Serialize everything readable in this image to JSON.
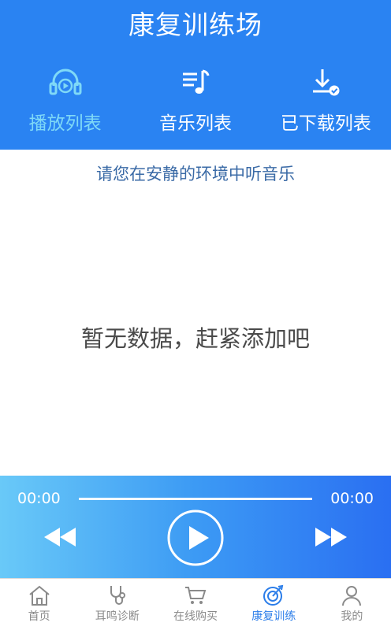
{
  "header": {
    "title": "康复训练场",
    "tabs": [
      {
        "label": "播放列表",
        "icon": "headphones-play-icon",
        "active": true
      },
      {
        "label": "音乐列表",
        "icon": "music-list-icon",
        "active": false
      },
      {
        "label": "已下载列表",
        "icon": "download-done-icon",
        "active": false
      }
    ]
  },
  "main": {
    "hint": "请您在安静的环境中听音乐",
    "empty_message": "暂无数据，赶紧添加吧"
  },
  "player": {
    "current_time": "00:00",
    "total_time": "00:00",
    "progress": 0,
    "controls": [
      "rewind-icon",
      "play-icon",
      "fast-forward-icon"
    ]
  },
  "tabbar": {
    "items": [
      {
        "label": "首页",
        "icon": "home-icon",
        "active": false
      },
      {
        "label": "耳鸣诊断",
        "icon": "stethoscope-icon",
        "active": false
      },
      {
        "label": "在线购买",
        "icon": "cart-icon",
        "active": false
      },
      {
        "label": "康复训练",
        "icon": "target-icon",
        "active": true
      },
      {
        "label": "我的",
        "icon": "user-icon",
        "active": false
      }
    ]
  },
  "colors": {
    "header_bg": "#2a83f2",
    "active_tab": "#7fd9f7",
    "hint_text": "#3a6aa6",
    "nav_active": "#2b7de9",
    "nav_inactive": "#8a8a8a"
  }
}
